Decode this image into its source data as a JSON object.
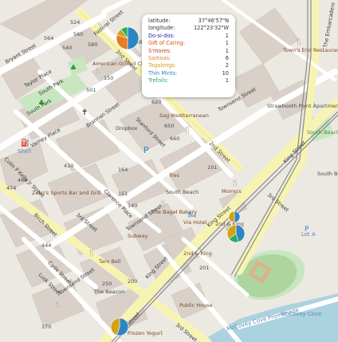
{
  "popup": {
    "latitude_label": "latitude:",
    "latitude_value": "37°46'57\"N",
    "longitude_label": "longitude:",
    "longitude_value": "122°23'32\"W",
    "rows": [
      {
        "label": "Do-si-dos:",
        "value": "1",
        "color": "#1a1aaa"
      },
      {
        "label": "Gift of Caring:",
        "value": "1",
        "color": "#d35400"
      },
      {
        "label": "S'mores:",
        "value": "1",
        "color": "#c0392b"
      },
      {
        "label": "Samoas:",
        "value": "6",
        "color": "#e67e22"
      },
      {
        "label": "Tagalongs:",
        "value": "2",
        "color": "#d4a017"
      },
      {
        "label": "Thin Mints:",
        "value": "10",
        "color": "#2e86c1"
      },
      {
        "label": "Trefoils:",
        "value": "1",
        "color": "#27ae60"
      }
    ]
  },
  "map": {
    "streets": {
      "bryant": "Bryant Street",
      "taylor": "Taylor Place",
      "south_park_n": "South Park",
      "south_park_s": "South Park",
      "varney": "Varney Place",
      "brannan": "Brannan Street",
      "second": "2nd Street",
      "stanford": "Stanford Street",
      "federal": "Federal Street",
      "townsend": "Townsend Street",
      "king1": "King Street",
      "king2": "King Street",
      "third1": "3rd Street",
      "third2": "3rd Street",
      "clarence": "Clarence Place",
      "colin": "Colin P Kelly Jr Street",
      "birch": "Birch Street",
      "cyde": "Cyde Street",
      "lusk": "Lusk Street",
      "townsend_w": "Townsend Street",
      "townsend_s": "Townsend Street",
      "king_s": "King Street",
      "king_sw": "King Street",
      "third_sw": "3rd Street",
      "embarcadero": "The Embarcadero",
      "mccovey": "McCovey Cove Promenade",
      "mccovey_cove": "McCovey Cove",
      "second_s": "2nd Street"
    },
    "pois": {
      "american_grilled": "American Grilled Cheese Kitchen",
      "towns_end": "Town's End Restaurant & Bakery",
      "sag": "Sag Mediterranean",
      "dropbox": "Dropbox",
      "strawbooth": "Strawbooth Point Apartments",
      "south_beach_park": "South Beach Park",
      "south_beach_harbor": "South Beach Harbor building",
      "tres": "Tres",
      "south_beach": "South Beach",
      "momos": "Momo's",
      "bagel": "The Bagel Bakery",
      "zeko": "Zeko's Sports Bar and Grill",
      "subway": "Subway",
      "tarro": "Taro Bell",
      "the_beacon": "The Beacon",
      "frozen": "Frozen Yogurt",
      "public_house": "Public House",
      "via_hotel": "Via Hotel",
      "second_king": "2nd & King",
      "second_king2": "2nd & King",
      "lot_a": "Lot A",
      "shell": "Shell",
      "n150": "150",
      "n175": "175",
      "n540": "540",
      "n585": "585",
      "n599": "599",
      "n650": "650",
      "n660": "660",
      "n101": "101",
      "n201": "201",
      "n250": "250",
      "n200": "200",
      "n180": "180",
      "n170": "170",
      "n560": "560",
      "n564": "564",
      "n580": "580",
      "n524": "524",
      "n501": "501",
      "n410": "410",
      "n480": "480",
      "n474": "474",
      "n164": "164",
      "n151": "151",
      "n140": "140",
      "n620": "620",
      "n444": "444"
    }
  },
  "pie_markers": [
    {
      "id": "pie-top",
      "slices": [
        {
          "color": "#2e86c1",
          "fraction": 0.5
        },
        {
          "color": "#e67e22",
          "fraction": 0.3
        },
        {
          "color": "#d4a017",
          "fraction": 0.1
        },
        {
          "color": "#27ae60",
          "fraction": 0.1
        }
      ]
    },
    {
      "id": "pie-right-small",
      "slices": [
        {
          "color": "#2e86c1",
          "fraction": 0.5
        },
        {
          "color": "#d4a017",
          "fraction": 0.5
        }
      ]
    },
    {
      "id": "pie-right",
      "slices": [
        {
          "color": "#2e86c1",
          "fraction": 0.45
        },
        {
          "color": "#27ae60",
          "fraction": 0.2
        },
        {
          "color": "#d4a017",
          "fraction": 0.35
        }
      ]
    },
    {
      "id": "pie-bottom",
      "slices": [
        {
          "color": "#2e86c1",
          "fraction": 0.55
        },
        {
          "color": "#d4a017",
          "fraction": 0.45
        }
      ]
    }
  ]
}
